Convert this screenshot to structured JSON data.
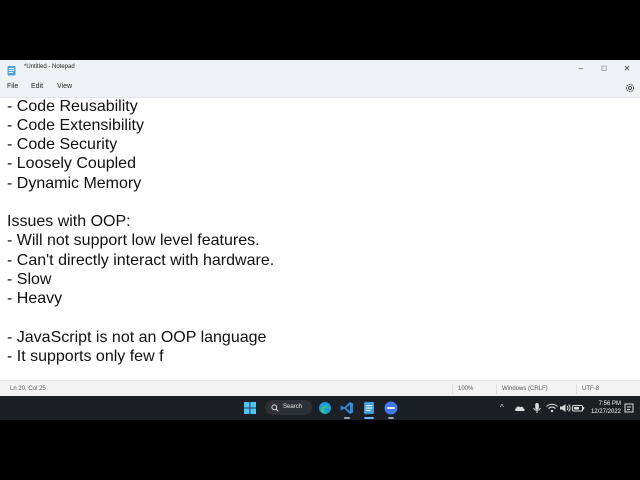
{
  "window": {
    "title": "*Untitled - Notepad",
    "controls": {
      "minimize": "–",
      "maximize": "◻",
      "close": "✕"
    }
  },
  "menu": {
    "file": "File",
    "edit": "Edit",
    "view": "View"
  },
  "editor": {
    "lines": [
      "- Code Reusability",
      "- Code Extensibility",
      "- Code Security",
      "- Loosely Coupled",
      "- Dynamic Memory",
      "",
      "Issues with OOP:",
      "- Will not support low level features.",
      "- Can't directly interact with hardware.",
      "- Slow",
      "- Heavy",
      "",
      "- JavaScript is not an OOP language",
      "- It supports only few f"
    ]
  },
  "status": {
    "position": "Ln 20, Col 25",
    "zoom": "100%",
    "line_ending": "Windows (CRLF)",
    "encoding": "UTF-8"
  },
  "taskbar": {
    "search_label": "Search",
    "pinned": [
      "windows-start-icon",
      "search-icon",
      "edge-icon",
      "vscode-icon",
      "notepad-icon",
      "app-icon"
    ],
    "tray": {
      "chevron": "^"
    },
    "clock": {
      "time": "7:56 PM",
      "date": "12/27/2022"
    }
  },
  "colors": {
    "taskbar": "#1c1f24",
    "titlebar": "#eef2f7",
    "accent": "#6cb4ff"
  }
}
